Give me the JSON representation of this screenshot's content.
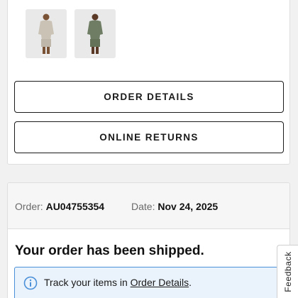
{
  "products": {
    "thumbnails": [
      {
        "alt": "product-photo-beige-outfit"
      },
      {
        "alt": "product-photo-green-outfit"
      }
    ]
  },
  "actions": {
    "order_details_label": "ORDER DETAILS",
    "online_returns_label": "ONLINE RETURNS"
  },
  "order": {
    "order_label": "Order:",
    "order_number": "AU04755354",
    "date_label": "Date:",
    "date_value": "Nov 24, 2025",
    "status_title": "Your order has been shipped.",
    "info": {
      "icon": "info-icon",
      "text_prefix": "Track your items in ",
      "link_text": "Order Details",
      "text_suffix": "."
    }
  },
  "feedback": {
    "label": "Feedback"
  },
  "colors": {
    "info_border": "#4a90d9",
    "info_background": "#eaf2fb",
    "button_border": "#1a1a1a"
  }
}
